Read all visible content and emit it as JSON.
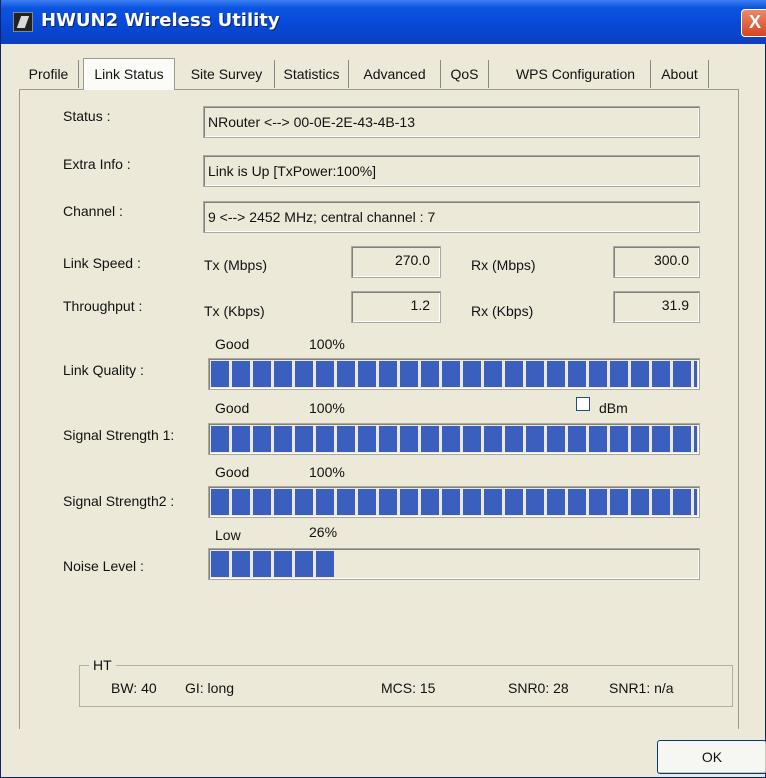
{
  "window": {
    "title": "HWUN2 Wireless Utility",
    "close_label": "X"
  },
  "tabs": [
    {
      "label": "Profile"
    },
    {
      "label": "Link Status"
    },
    {
      "label": "Site Survey"
    },
    {
      "label": "Statistics"
    },
    {
      "label": "Advanced"
    },
    {
      "label": "QoS"
    },
    {
      "label": "WPS Configuration"
    },
    {
      "label": "About"
    }
  ],
  "status": {
    "label": "Status :",
    "value": "NRouter <--> 00-0E-2E-43-4B-13"
  },
  "extra_info": {
    "label": "Extra Info :",
    "value": "Link is Up [TxPower:100%]"
  },
  "channel": {
    "label": "Channel :",
    "value": "9 <--> 2452 MHz; central channel : 7"
  },
  "link_speed": {
    "label": "Link Speed :",
    "tx_label": "Tx (Mbps)",
    "tx_value": "270.0",
    "rx_label": "Rx (Mbps)",
    "rx_value": "300.0"
  },
  "throughput": {
    "label": "Throughput :",
    "tx_label": "Tx (Kbps)",
    "tx_value": "1.2",
    "rx_label": "Rx (Kbps)",
    "rx_value": "31.9"
  },
  "link_quality": {
    "label": "Link Quality :",
    "quality": "Good",
    "percent": "100%",
    "fraction": 1.0
  },
  "dbm": {
    "label": "dBm",
    "checked": false
  },
  "signal_strength_1": {
    "label": "Signal Strength 1:",
    "quality": "Good",
    "percent": "100%",
    "fraction": 1.0
  },
  "signal_strength_2": {
    "label": "Signal Strength2 :",
    "quality": "Good",
    "percent": "100%",
    "fraction": 1.0
  },
  "noise_level": {
    "label": "Noise Level :",
    "quality": "Low",
    "percent": "26%",
    "fraction": 0.26
  },
  "ht": {
    "title": "HT",
    "bw": "BW: 40",
    "gi": "GI: long",
    "mcs": "MCS: 15",
    "snr0": "SNR0: 28",
    "snr1": "SNR1: n/a"
  },
  "ok_button": {
    "label": "OK"
  },
  "colors": {
    "bar_fill": "#3b5fbf",
    "titlebar": "#0b54e0",
    "close_button": "#d5451d"
  }
}
